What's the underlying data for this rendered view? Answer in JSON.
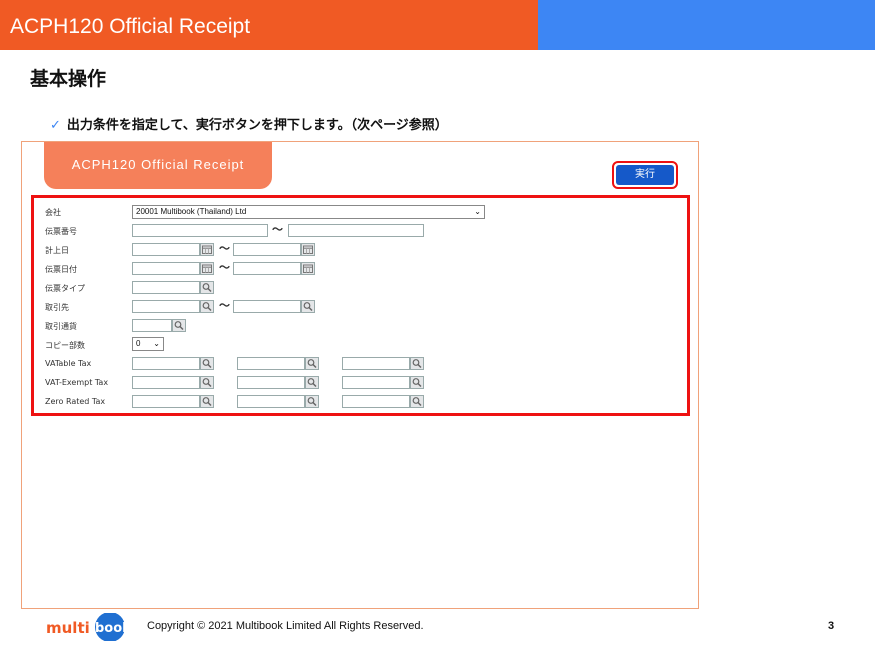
{
  "header": {
    "title": "ACPH120 Official Receipt",
    "colors": {
      "orange": "#f05a24",
      "blue": "#3d86f4"
    }
  },
  "section_title": "基本操作",
  "bullet": {
    "icon": "check-icon",
    "text": "出力条件を指定して、実行ボタンを押下します。（次ページ参照）"
  },
  "screen": {
    "tab_title": "ACPH120 Official Receipt",
    "run_button": "実行",
    "form": {
      "company": {
        "label": "会社",
        "value": "20001 Multibook (Thailand) Ltd"
      },
      "voucher_no": {
        "label": "伝票番号",
        "sep": "〜"
      },
      "posting_date": {
        "label": "計上日",
        "sep": "〜"
      },
      "voucher_date": {
        "label": "伝票日付",
        "sep": "〜"
      },
      "voucher_type": {
        "label": "伝票タイプ"
      },
      "partner": {
        "label": "取引先",
        "sep": "〜"
      },
      "currency": {
        "label": "取引通貨"
      },
      "copies": {
        "label": "コピー部数",
        "value": "0"
      },
      "vatable": {
        "label": "VATable Tax"
      },
      "vat_exempt": {
        "label": "VAT-Exempt Tax"
      },
      "zero_rated": {
        "label": "Zero Rated Tax"
      }
    }
  },
  "footer": {
    "logo": "multibook",
    "copyright": "Copyright © 2021 Multibook Limited All Rights Reserved.",
    "page": "3"
  }
}
